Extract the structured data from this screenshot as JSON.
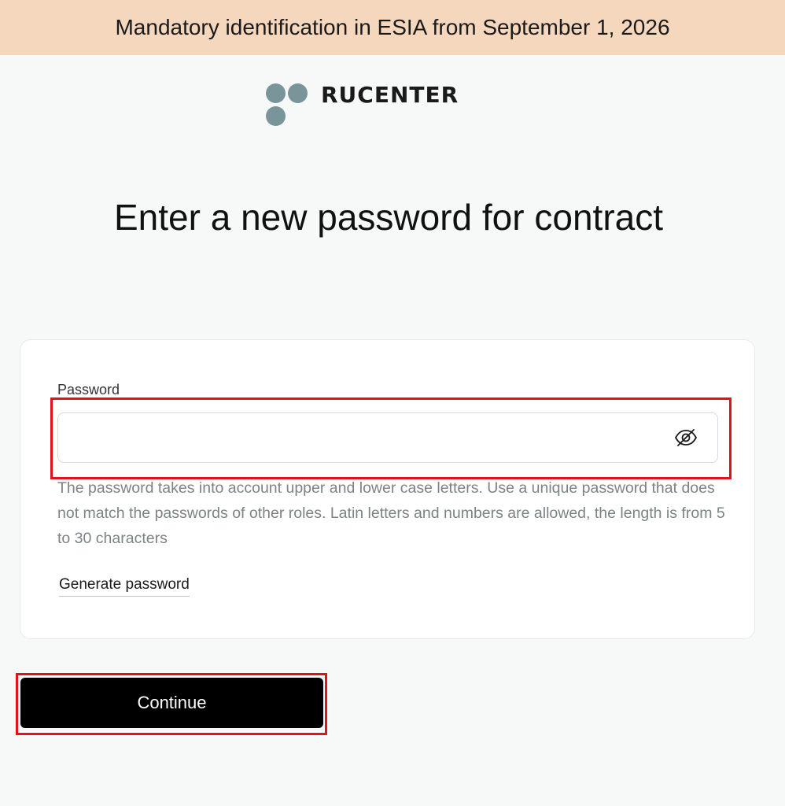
{
  "banner": {
    "text": "Mandatory identification in ESIA from September 1, 2026"
  },
  "logo": {
    "text": "RUCENTER",
    "dot_color": "#7a9599"
  },
  "page": {
    "title": "Enter a new password for contract"
  },
  "form": {
    "password_label": "Password",
    "password_value": "",
    "toggle_icon": "eye-slash-icon",
    "hint": "The password takes into account upper and lower case letters. Use a unique password that does not match the passwords of other roles. Latin letters and numbers are allowed, the length is from 5 to 30 characters",
    "generate_link": "Generate password"
  },
  "actions": {
    "continue_label": "Continue"
  },
  "colors": {
    "banner_bg": "#f5d7bd",
    "page_bg": "#f7f9f8",
    "button_bg": "#000000",
    "highlight": "#e3111b"
  }
}
